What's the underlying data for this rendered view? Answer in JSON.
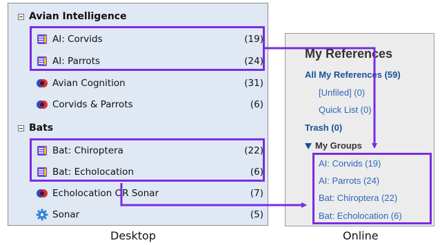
{
  "desktop": {
    "groups": [
      {
        "title": "Avian Intelligence",
        "items": [
          {
            "label": "AI: Corvids",
            "count": "(19)",
            "icon": "group-icon"
          },
          {
            "label": "AI: Parrots",
            "count": "(24)",
            "icon": "group-icon"
          },
          {
            "label": "Avian Cognition",
            "count": "(31)",
            "icon": "combined-group-icon"
          },
          {
            "label": "Corvids & Parrots",
            "count": "(6)",
            "icon": "combined-group-icon"
          }
        ]
      },
      {
        "title": "Bats",
        "items": [
          {
            "label": "Bat: Chiroptera",
            "count": "(22)",
            "icon": "group-icon"
          },
          {
            "label": "Bat: Echolocation",
            "count": "(6)",
            "icon": "group-icon"
          },
          {
            "label": "Echolocation OR Sonar",
            "count": "(7)",
            "icon": "combined-group-icon"
          },
          {
            "label": "Sonar",
            "count": "(5)",
            "icon": "smart-group-gear-icon"
          }
        ]
      }
    ],
    "caption": "Desktop"
  },
  "online": {
    "title": "My References",
    "all_refs": "All My References (59)",
    "unfiled": "[Unfiled] (0)",
    "quick_list": "Quick List (0)",
    "trash": "Trash (0)",
    "my_groups": "My Groups",
    "groups": [
      "AI: Corvids  (19)",
      "AI: Parrots  (24)",
      "Bat: Chiroptera  (22)",
      "Bat: Echolocation  (6)"
    ],
    "caption": "Online"
  },
  "colors": {
    "highlight": "#7a2be2",
    "desktop_bg": "#dfe8f3",
    "online_bg": "#ececec",
    "link": "#2f66b8"
  }
}
